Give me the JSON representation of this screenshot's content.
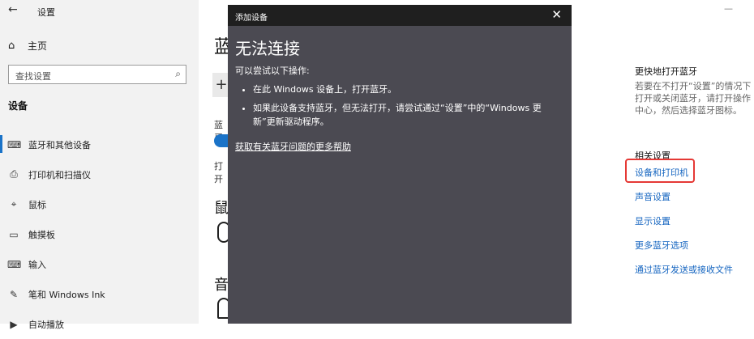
{
  "window": {
    "title": "设置",
    "back_glyph": "←"
  },
  "sidebar": {
    "home_label": "主页",
    "search_placeholder": "查找设置",
    "section_title": "设备",
    "items": [
      {
        "label": "蓝牙和其他设备",
        "icon": "bluetooth-devices-icon",
        "glyph": "⌨",
        "active": true
      },
      {
        "label": "打印机和扫描仪",
        "icon": "printer-icon",
        "glyph": "⎙"
      },
      {
        "label": "鼠标",
        "icon": "mouse-icon",
        "glyph": "⌖"
      },
      {
        "label": "触摸板",
        "icon": "touchpad-icon",
        "glyph": "▭"
      },
      {
        "label": "输入",
        "icon": "keyboard-icon",
        "glyph": "⌨"
      },
      {
        "label": "笔和 Windows Ink",
        "icon": "pen-icon",
        "glyph": "✎"
      },
      {
        "label": "自动播放",
        "icon": "autoplay-icon",
        "glyph": "▶"
      }
    ]
  },
  "main": {
    "title_partial": "蓝",
    "bluetooth_label_partial": "蓝牙",
    "on_label_partial": "打开",
    "mouse_heading_partial": "鼠",
    "audio_heading_partial": "音"
  },
  "dialog": {
    "window_title": "添加设备",
    "heading": "无法连接",
    "intro": "可以尝试以下操作:",
    "bullets": [
      "在此 Windows 设备上，打开蓝牙。",
      "如果此设备支持蓝牙，但无法打开，请尝试通过“设置”中的“Windows 更新”更新驱动程序。"
    ],
    "help_link": "获取有关蓝牙问题的更多帮助",
    "close_glyph": "✕"
  },
  "right_panel": {
    "heading1": "更快地打开蓝牙",
    "description": "若要在不打开“设置”的情况下打开或关闭蓝牙，请打开操作中心，然后选择蓝牙图标。",
    "heading2": "相关设置",
    "links": [
      "设备和打印机",
      "声音设置",
      "显示设置",
      "更多蓝牙选项",
      "通过蓝牙发送或接收文件"
    ],
    "highlight_color": "#e53935"
  },
  "colors": {
    "accent": "#1a73c8",
    "dialog_bg": "#4b4a52",
    "titlebar_bg": "#1f1f1f",
    "link": "#1565c0"
  }
}
